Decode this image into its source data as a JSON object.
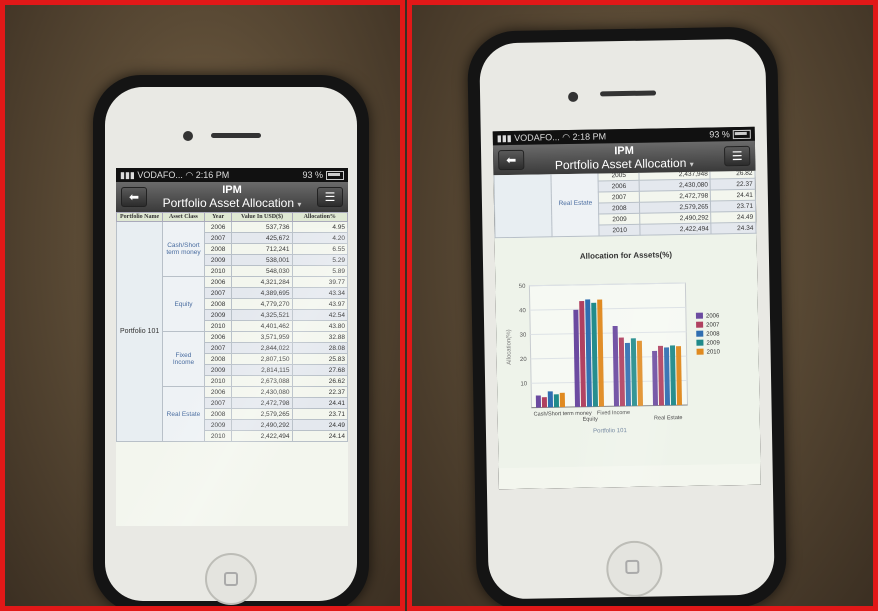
{
  "app": {
    "carrier": "VODAFO...",
    "time_left": "2:16 PM",
    "time_right": "2:18 PM",
    "battery": "93 %",
    "title": "IPM",
    "subtitle": "Portfolio Asset Allocation",
    "dropdown_glyph": "▾",
    "back_icon": "back-arrow-icon",
    "menu_icon": "menu-icon"
  },
  "colors": {
    "frame_border": "#e11818",
    "header_bg": "#dfe8d3",
    "class_text": "#4a6da0"
  },
  "table": {
    "headers": [
      "Portfolio Name",
      "Asset Class",
      "Year",
      "Value In USD($)",
      "Allocation%"
    ],
    "portfolio": "Portfolio 101",
    "groups": [
      {
        "class": "Cash/Short term money",
        "rows": [
          [
            "2006",
            "537,736",
            "4.95"
          ],
          [
            "2007",
            "425,672",
            "4.20"
          ],
          [
            "2008",
            "712,241",
            "6.55"
          ],
          [
            "2009",
            "538,001",
            "5.29"
          ],
          [
            "2010",
            "548,030",
            "5.89"
          ]
        ]
      },
      {
        "class": "Equity",
        "rows": [
          [
            "2006",
            "4,321,284",
            "39.77"
          ],
          [
            "2007",
            "4,389,695",
            "43.34"
          ],
          [
            "2008",
            "4,779,270",
            "43.97"
          ],
          [
            "2009",
            "4,325,521",
            "42.54"
          ],
          [
            "2010",
            "4,401,462",
            "43.80"
          ]
        ]
      },
      {
        "class": "Fixed Income",
        "rows": [
          [
            "2006",
            "3,571,959",
            "32.88"
          ],
          [
            "2007",
            "2,844,022",
            "28.08"
          ],
          [
            "2008",
            "2,807,150",
            "25.83"
          ],
          [
            "2009",
            "2,814,115",
            "27.68"
          ],
          [
            "2010",
            "2,673,088",
            "26.62"
          ]
        ]
      },
      {
        "class": "Real Estate",
        "rows": [
          [
            "2006",
            "2,430,080",
            "22.37"
          ],
          [
            "2007",
            "2,472,798",
            "24.41"
          ],
          [
            "2008",
            "2,579,265",
            "23.71"
          ],
          [
            "2009",
            "2,490,292",
            "24.49"
          ],
          [
            "2010",
            "2,422,494",
            "24.14"
          ]
        ]
      }
    ],
    "right_partial_top": [
      "2005",
      "2,437,948",
      "26.82"
    ],
    "right_class": "Real Estate",
    "right_rows": [
      [
        "2006",
        "2,430,080",
        "22.37"
      ],
      [
        "2007",
        "2,472,798",
        "24.41"
      ],
      [
        "2008",
        "2,579,265",
        "23.71"
      ],
      [
        "2009",
        "2,490,292",
        "24.49"
      ],
      [
        "2010",
        "2,422,494",
        "24.34"
      ]
    ]
  },
  "chart_data": {
    "type": "bar",
    "title": "Allocation for Assets(%)",
    "ylabel": "Allocation(%)",
    "xlabel": "Portfolio 101",
    "ylim": [
      0,
      50
    ],
    "yticks": [
      10,
      20,
      30,
      40,
      50
    ],
    "categories": [
      "Cash/Short term money",
      "Equity",
      "Fixed Income",
      "Real Estate"
    ],
    "series": [
      {
        "name": "2006",
        "color": "#6b4aa0",
        "values": [
          4.95,
          39.77,
          32.88,
          22.37
        ]
      },
      {
        "name": "2007",
        "color": "#b04060",
        "values": [
          4.2,
          43.34,
          28.08,
          24.41
        ]
      },
      {
        "name": "2008",
        "color": "#2f6db0",
        "values": [
          6.55,
          43.97,
          25.83,
          23.71
        ]
      },
      {
        "name": "2009",
        "color": "#1f8a8a",
        "values": [
          5.29,
          42.54,
          27.68,
          24.49
        ]
      },
      {
        "name": "2010",
        "color": "#e08a20",
        "values": [
          5.89,
          43.8,
          26.62,
          24.14
        ]
      }
    ],
    "legend_position": "right"
  }
}
